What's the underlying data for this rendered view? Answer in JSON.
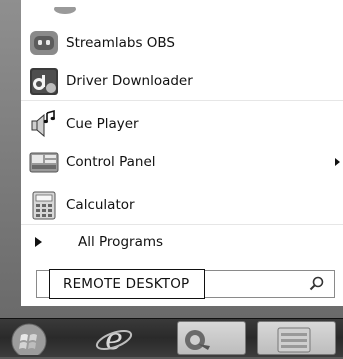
{
  "menu": {
    "items": [
      {
        "label": "Streamlabs OBS",
        "icon": "streamlabs-obs-icon",
        "submenu": false
      },
      {
        "label": "Driver Downloader",
        "icon": "driver-downloader-icon",
        "submenu": false
      },
      {
        "label": "Cue Player",
        "icon": "cue-player-icon",
        "submenu": false
      },
      {
        "label": "Control Panel",
        "icon": "control-panel-icon",
        "submenu": true
      },
      {
        "label": "Calculator",
        "icon": "calculator-icon",
        "submenu": false
      }
    ],
    "all_programs_label": "All Programs"
  },
  "search": {
    "value": "",
    "callout_text": "REMOTE DESKTOP",
    "icon": "search-icon"
  },
  "taskbar": {
    "icons": [
      "start-orb-icon",
      "internet-explorer-icon",
      "driver-app-icon",
      "file-explorer-icon"
    ]
  },
  "colors": {
    "menu_bg": "#ffffff",
    "frame": "#7a7a7a",
    "taskbar": "#2f2f2f"
  }
}
